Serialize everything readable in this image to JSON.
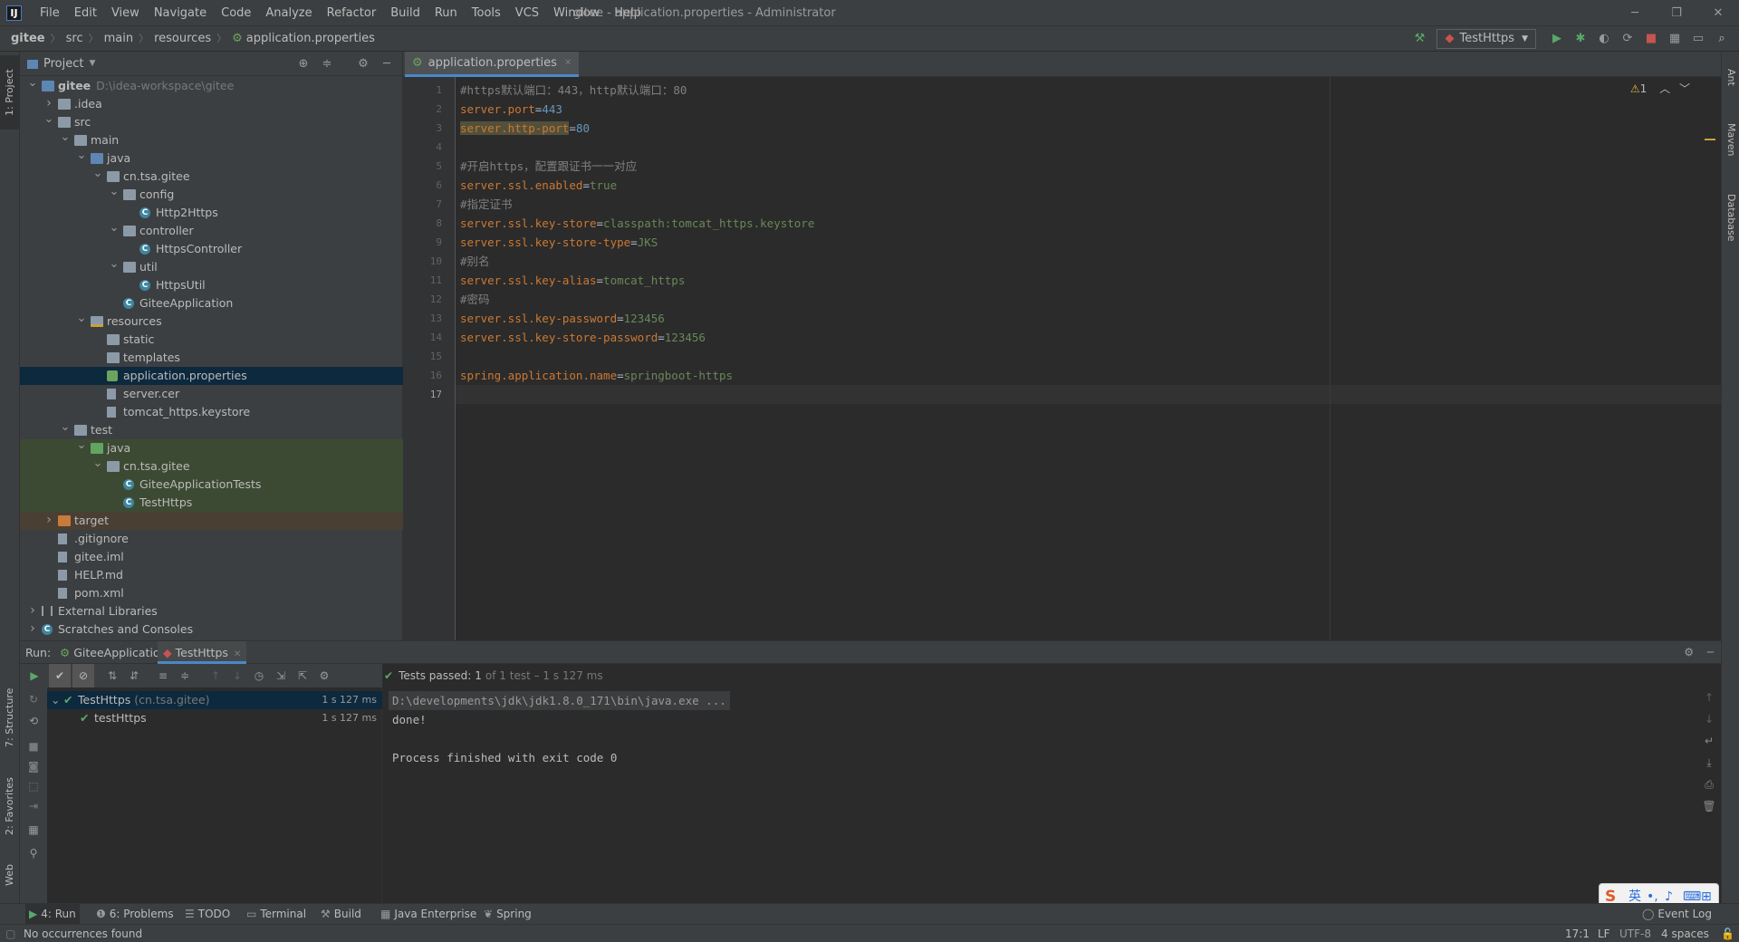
{
  "app": {
    "logo": "IJ",
    "title": "gitee - application.properties - Administrator"
  },
  "menu": [
    "File",
    "Edit",
    "View",
    "Navigate",
    "Code",
    "Analyze",
    "Refactor",
    "Build",
    "Run",
    "Tools",
    "VCS",
    "Window",
    "Help"
  ],
  "breadcrumb": [
    "gitee",
    "src",
    "main",
    "resources",
    "application.properties"
  ],
  "run_config": "TestHttps",
  "project_panel": {
    "title": "Project"
  },
  "tree": [
    {
      "label": "gitee",
      "extra": "D:\\idea-workspace\\gitee",
      "depth": 0,
      "arrow": "open",
      "icon": "folder-module",
      "bold": true
    },
    {
      "label": ".idea",
      "depth": 1,
      "arrow": "closed",
      "icon": "folder"
    },
    {
      "label": "src",
      "depth": 1,
      "arrow": "open",
      "icon": "folder"
    },
    {
      "label": "main",
      "depth": 2,
      "arrow": "open",
      "icon": "folder"
    },
    {
      "label": "java",
      "depth": 3,
      "arrow": "open",
      "icon": "folder-blue"
    },
    {
      "label": "cn.tsa.gitee",
      "depth": 4,
      "arrow": "open",
      "icon": "folder"
    },
    {
      "label": "config",
      "depth": 5,
      "arrow": "open",
      "icon": "folder"
    },
    {
      "label": "Http2Https",
      "depth": 6,
      "arrow": "none",
      "icon": "class"
    },
    {
      "label": "controller",
      "depth": 5,
      "arrow": "open",
      "icon": "folder"
    },
    {
      "label": "HttpsController",
      "depth": 6,
      "arrow": "none",
      "icon": "class"
    },
    {
      "label": "util",
      "depth": 5,
      "arrow": "open",
      "icon": "folder"
    },
    {
      "label": "HttpsUtil",
      "depth": 6,
      "arrow": "none",
      "icon": "class"
    },
    {
      "label": "GiteeApplication",
      "depth": 5,
      "arrow": "none",
      "icon": "class"
    },
    {
      "label": "resources",
      "depth": 3,
      "arrow": "open",
      "icon": "folder-res"
    },
    {
      "label": "static",
      "depth": 4,
      "arrow": "none",
      "icon": "folder"
    },
    {
      "label": "templates",
      "depth": 4,
      "arrow": "none",
      "icon": "folder"
    },
    {
      "label": "application.properties",
      "depth": 4,
      "arrow": "none",
      "icon": "properties",
      "selected": true
    },
    {
      "label": "server.cer",
      "depth": 4,
      "arrow": "none",
      "icon": "file"
    },
    {
      "label": "tomcat_https.keystore",
      "depth": 4,
      "arrow": "none",
      "icon": "file"
    },
    {
      "label": "test",
      "depth": 2,
      "arrow": "open",
      "icon": "folder"
    },
    {
      "label": "java",
      "depth": 3,
      "arrow": "open",
      "icon": "folder-green",
      "testbg": true
    },
    {
      "label": "cn.tsa.gitee",
      "depth": 4,
      "arrow": "open",
      "icon": "folder",
      "testbg": true
    },
    {
      "label": "GiteeApplicationTests",
      "depth": 5,
      "arrow": "none",
      "icon": "class",
      "testbg": true
    },
    {
      "label": "TestHttps",
      "depth": 5,
      "arrow": "none",
      "icon": "class",
      "testbg": true
    },
    {
      "label": "target",
      "depth": 1,
      "arrow": "closed",
      "icon": "folder-orange",
      "excluded": true
    },
    {
      "label": ".gitignore",
      "depth": 1,
      "arrow": "none",
      "icon": "file"
    },
    {
      "label": "gitee.iml",
      "depth": 1,
      "arrow": "none",
      "icon": "file"
    },
    {
      "label": "HELP.md",
      "depth": 1,
      "arrow": "none",
      "icon": "file"
    },
    {
      "label": "pom.xml",
      "depth": 1,
      "arrow": "none",
      "icon": "file"
    },
    {
      "label": "External Libraries",
      "depth": 0,
      "arrow": "closed",
      "icon": "library"
    },
    {
      "label": "Scratches and Consoles",
      "depth": 0,
      "arrow": "closed",
      "icon": "scratch"
    }
  ],
  "editor": {
    "tab": "application.properties",
    "warnings": "1",
    "current_line": 17,
    "lines": [
      [
        {
          "t": "#https默认端口：443，http默认端口：80",
          "c": "c"
        }
      ],
      [
        {
          "t": "server.port",
          "c": "k"
        },
        {
          "t": "=",
          "c": "eq"
        },
        {
          "t": "443",
          "c": "n"
        }
      ],
      [
        {
          "t": "server.http-port",
          "c": "k hl"
        },
        {
          "t": "=",
          "c": "eq"
        },
        {
          "t": "80",
          "c": "n"
        }
      ],
      [],
      [
        {
          "t": "#开启https，配置跟证书一一对应",
          "c": "c"
        }
      ],
      [
        {
          "t": "server.ssl.enabled",
          "c": "k"
        },
        {
          "t": "=",
          "c": "eq"
        },
        {
          "t": "true",
          "c": "v"
        }
      ],
      [
        {
          "t": "#指定证书",
          "c": "c"
        }
      ],
      [
        {
          "t": "server.ssl.key-store",
          "c": "k"
        },
        {
          "t": "=",
          "c": "eq"
        },
        {
          "t": "classpath:tomcat_https.keystore",
          "c": "v"
        }
      ],
      [
        {
          "t": "server.ssl.key-store-type",
          "c": "k"
        },
        {
          "t": "=",
          "c": "eq"
        },
        {
          "t": "JKS",
          "c": "v"
        }
      ],
      [
        {
          "t": "#别名",
          "c": "c"
        }
      ],
      [
        {
          "t": "server.ssl.key-alias",
          "c": "k"
        },
        {
          "t": "=",
          "c": "eq"
        },
        {
          "t": "tomcat_https",
          "c": "v"
        }
      ],
      [
        {
          "t": "#密码",
          "c": "c"
        }
      ],
      [
        {
          "t": "server.ssl.key-password",
          "c": "k"
        },
        {
          "t": "=",
          "c": "eq"
        },
        {
          "t": "123456",
          "c": "v"
        }
      ],
      [
        {
          "t": "server.ssl.key-store-password",
          "c": "k"
        },
        {
          "t": "=",
          "c": "eq"
        },
        {
          "t": "123456",
          "c": "v"
        }
      ],
      [],
      [
        {
          "t": "spring.application.name",
          "c": "k"
        },
        {
          "t": "=",
          "c": "eq"
        },
        {
          "t": "springboot-https",
          "c": "v"
        }
      ],
      []
    ]
  },
  "run": {
    "label": "Run:",
    "tabs": [
      {
        "label": "GiteeApplication"
      },
      {
        "label": "TestHttps",
        "active": true
      }
    ],
    "status_prefix": "Tests passed:",
    "status_count": "1",
    "status_rest": "of 1 test – 1 s 127 ms",
    "tests": [
      {
        "name": "TestHttps",
        "pkg": "(cn.tsa.gitee)",
        "time": "1 s 127 ms",
        "depth": 0,
        "selected": true
      },
      {
        "name": "testHttps",
        "pkg": "",
        "time": "1 s 127 ms",
        "depth": 1
      }
    ],
    "console": [
      "D:\\developments\\jdk\\jdk1.8.0_171\\bin\\java.exe ...",
      "done!",
      "",
      "Process finished with exit code 0"
    ]
  },
  "left_strip": [
    "1: Project",
    "7: Structure",
    "2: Favorites",
    "Web"
  ],
  "right_strip": [
    "Ant",
    "Maven",
    "Database"
  ],
  "bottom_tabs": [
    {
      "label": "4: Run",
      "icon": "run-icon",
      "active": true
    },
    {
      "label": "6: Problems",
      "icon": "problems-icon"
    },
    {
      "label": "TODO",
      "icon": "todo-icon"
    },
    {
      "label": "Terminal",
      "icon": "terminal-icon"
    },
    {
      "label": "Build",
      "icon": "build-icon"
    },
    {
      "label": "Java Enterprise",
      "icon": "java-enterprise-icon"
    },
    {
      "label": "Spring",
      "icon": "spring-icon"
    }
  ],
  "event_log": "Event Log",
  "status": {
    "message": "No occurrences found",
    "position": "17:1",
    "line_sep": "LF",
    "encoding": "UTF-8",
    "indent": "4 spaces"
  },
  "ime": {
    "lang": "英"
  }
}
